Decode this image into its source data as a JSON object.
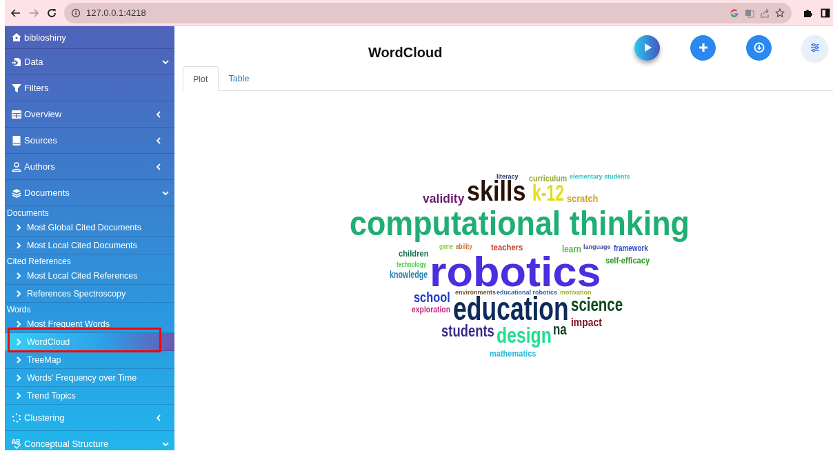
{
  "browser": {
    "url": "127.0.0.1:4218"
  },
  "sidebar": {
    "items": [
      {
        "kind": "brand",
        "label": "biblioshiny"
      },
      {
        "kind": "menu",
        "label": "Data",
        "expanded": true
      },
      {
        "kind": "link",
        "label": "Filters"
      },
      {
        "kind": "menu",
        "label": "Overview",
        "expanded": false
      },
      {
        "kind": "menu",
        "label": "Sources",
        "expanded": false
      },
      {
        "kind": "menu",
        "label": "Authors",
        "expanded": false
      },
      {
        "kind": "menu",
        "label": "Documents",
        "expanded": true,
        "children": [
          {
            "kind": "section",
            "label": "Documents"
          },
          {
            "kind": "subitem",
            "label": "Most Global Cited Documents",
            "selected": false
          },
          {
            "kind": "subitem",
            "label": "Most Local Cited Documents",
            "selected": false
          },
          {
            "kind": "section",
            "label": "Cited References"
          },
          {
            "kind": "subitem",
            "label": "Most Local Cited References",
            "selected": false
          },
          {
            "kind": "subitem",
            "label": "References Spectroscopy",
            "selected": false
          },
          {
            "kind": "section",
            "label": "Words"
          },
          {
            "kind": "subitem",
            "label": "Most Frequent Words",
            "selected": false
          },
          {
            "kind": "subitem",
            "label": "WordCloud",
            "selected": true
          },
          {
            "kind": "subitem",
            "label": "TreeMap",
            "selected": false
          },
          {
            "kind": "subitem",
            "label": "Words' Frequency over Time",
            "selected": false
          },
          {
            "kind": "subitem",
            "label": "Trend Topics",
            "selected": false
          }
        ]
      },
      {
        "kind": "menu",
        "label": "Clustering",
        "expanded": false
      },
      {
        "kind": "menu",
        "label": "Conceptual Structure",
        "expanded": true
      }
    ]
  },
  "main": {
    "title": "WordCloud",
    "tabs": [
      {
        "label": "Plot",
        "selected": true
      },
      {
        "label": "Table",
        "selected": false
      }
    ],
    "word_cloud": {
      "words": [
        {
          "text": "literacy",
          "color": "#203060"
        },
        {
          "text": "curriculum",
          "color": "#9aa833"
        },
        {
          "text": "elementary students",
          "color": "#30c0c0"
        },
        {
          "text": "skills",
          "color": "#2b1208"
        },
        {
          "text": "k-12",
          "color": "#dede1e"
        },
        {
          "text": "validity",
          "color": "#6a1a6e"
        },
        {
          "text": "scratch",
          "color": "#d4a020"
        },
        {
          "text": "computational thinking",
          "color": "#1fae74"
        },
        {
          "text": "game",
          "color": "#9ad040"
        },
        {
          "text": "ability",
          "color": "#d07030"
        },
        {
          "text": "teachers",
          "color": "#c04020"
        },
        {
          "text": "learn",
          "color": "#50c040"
        },
        {
          "text": "language",
          "color": "#4050a0"
        },
        {
          "text": "framework",
          "color": "#3050c0"
        },
        {
          "text": "children",
          "color": "#1a7050"
        },
        {
          "text": "robotics",
          "color": "#4b2ee0"
        },
        {
          "text": "self-efficacy",
          "color": "#2a9a20"
        },
        {
          "text": "technology",
          "color": "#48d040"
        },
        {
          "text": "knowledge",
          "color": "#2a80b0"
        },
        {
          "text": "school",
          "color": "#1a3ccf"
        },
        {
          "text": "environments",
          "color": "#705030"
        },
        {
          "text": "educational robotics",
          "color": "#3060a0"
        },
        {
          "text": "motivation",
          "color": "#9ab020"
        },
        {
          "text": "education",
          "color": "#0f2a5a"
        },
        {
          "text": "science",
          "color": "#0a4a1a"
        },
        {
          "text": "exploration",
          "color": "#c0287a"
        },
        {
          "text": "impact",
          "color": "#7a1020"
        },
        {
          "text": "students",
          "color": "#3a2a8a"
        },
        {
          "text": "design",
          "color": "#1fe090"
        },
        {
          "text": "na",
          "color": "#153a2a"
        },
        {
          "text": "mathematics",
          "color": "#28b8d8"
        }
      ]
    }
  }
}
